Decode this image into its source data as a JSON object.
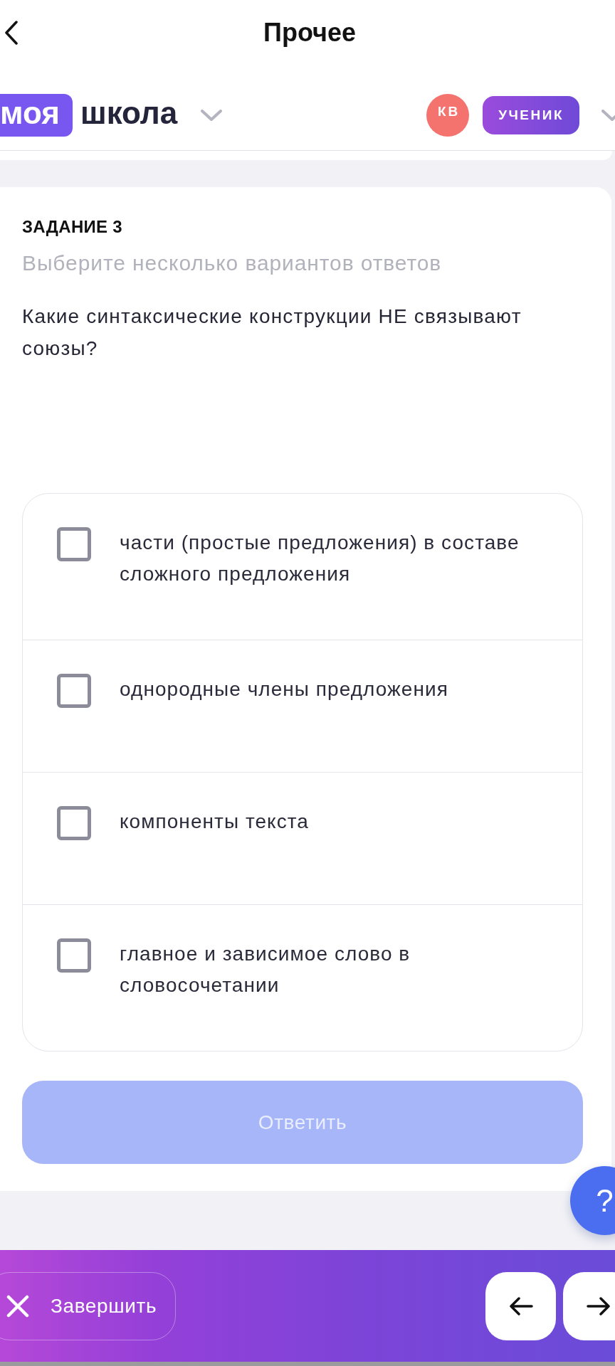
{
  "header": {
    "title": "Прочее"
  },
  "school_bar": {
    "logo_badge": "моя",
    "logo_text": "школа",
    "avatar": "КВ",
    "role": "УЧЕНИК"
  },
  "task": {
    "heading": "ЗАДАНИЕ 3",
    "instruction": "Выберите несколько вариантов ответов",
    "question": "Какие синтаксические конструкции НЕ связывают союзы?",
    "options": [
      {
        "text": "части (простые предложения) в составе сложного предложения",
        "checked": false
      },
      {
        "text": "однородные члены предложения",
        "checked": false
      },
      {
        "text": "компоненты текста",
        "checked": false
      },
      {
        "text": "главное и зависимое слово в словосочетании",
        "checked": false
      }
    ],
    "submit": {
      "label": "Ответить",
      "disabled": true
    }
  },
  "help_button": {
    "label": "?"
  },
  "bottom_bar": {
    "finish": {
      "label": "Завершить"
    }
  }
}
